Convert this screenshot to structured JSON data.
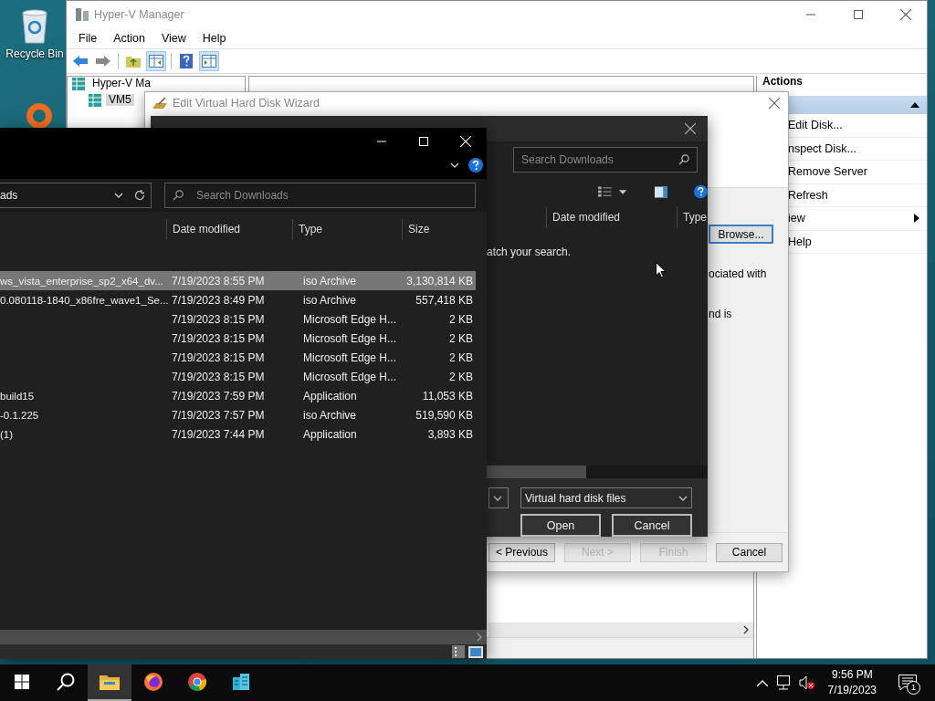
{
  "desktop": {
    "icons": [
      {
        "label": "Recycle Bin"
      }
    ]
  },
  "hyperv": {
    "title": "Hyper-V Manager",
    "menu": [
      "File",
      "Action",
      "View",
      "Help"
    ],
    "tree": [
      {
        "label": "Hyper-V Ma",
        "selected": false,
        "children": [
          {
            "label": "VM5",
            "selected": true
          }
        ]
      }
    ],
    "actions": {
      "header": "Actions",
      "group_expanded": true,
      "items": [
        {
          "label": "Edit Disk...",
          "kind": "command"
        },
        {
          "label": "nspect Disk...",
          "kind": "command"
        },
        {
          "label": "Remove Server",
          "kind": "command"
        },
        {
          "label": "Refresh",
          "kind": "command"
        },
        {
          "label": "iew",
          "kind": "submenu"
        },
        {
          "label": "Help",
          "kind": "command"
        }
      ]
    }
  },
  "wizard": {
    "title": "Edit Virtual Hard Disk Wizard",
    "browse_button": "Browse...",
    "text_fragments": [
      "ociated with",
      "nd is"
    ],
    "buttons": [
      {
        "label": "< Previous",
        "disabled": false
      },
      {
        "label": "Next >",
        "disabled": true
      },
      {
        "label": "Finish",
        "disabled": true
      },
      {
        "label": "Cancel",
        "disabled": false
      }
    ]
  },
  "open_dialog": {
    "search_placeholder": "Search Downloads",
    "columns": [
      "Date modified",
      "Type"
    ],
    "message": "atch your search.",
    "file_type": "Virtual hard disk files",
    "buttons": [
      "Open",
      "Cancel"
    ]
  },
  "explorer": {
    "address": "ads",
    "search_placeholder": "Search Downloads",
    "columns": [
      "Date modified",
      "Type",
      "Size"
    ],
    "rows": [
      {
        "name": "ws_vista_enterprise_sp2_x64_dv...",
        "date": "7/19/2023 8:55 PM",
        "type": "iso Archive",
        "size": "3,130,814 KB",
        "selected": true
      },
      {
        "name": "0.080118-1840_x86fre_wave1_Se...",
        "date": "7/19/2023 8:49 PM",
        "type": "iso Archive",
        "size": "557,418 KB",
        "selected": false
      },
      {
        "name": "",
        "date": "7/19/2023 8:15 PM",
        "type": "Microsoft Edge H...",
        "size": "2 KB",
        "selected": false
      },
      {
        "name": "",
        "date": "7/19/2023 8:15 PM",
        "type": "Microsoft Edge H...",
        "size": "2 KB",
        "selected": false
      },
      {
        "name": "",
        "date": "7/19/2023 8:15 PM",
        "type": "Microsoft Edge H...",
        "size": "2 KB",
        "selected": false
      },
      {
        "name": "",
        "date": "7/19/2023 8:15 PM",
        "type": "Microsoft Edge H...",
        "size": "2 KB",
        "selected": false
      },
      {
        "name": "build15",
        "date": "7/19/2023 7:59 PM",
        "type": "Application",
        "size": "11,053 KB",
        "selected": false
      },
      {
        "name": "-0.1.225",
        "date": "7/19/2023 7:57 PM",
        "type": "iso Archive",
        "size": "519,590 KB",
        "selected": false
      },
      {
        "name": "(1)",
        "date": "7/19/2023 7:44 PM",
        "type": "Application",
        "size": "3,893 KB",
        "selected": false
      }
    ]
  },
  "taskbar": {
    "apps": [
      {
        "kind": "explorer",
        "active": true
      },
      {
        "kind": "firefox",
        "active": false
      },
      {
        "kind": "chrome",
        "active": false
      },
      {
        "kind": "hyperv",
        "active": false
      }
    ],
    "volume_muted": true,
    "time": "9:56 PM",
    "date": "7/19/2023",
    "notification_count": "1"
  }
}
